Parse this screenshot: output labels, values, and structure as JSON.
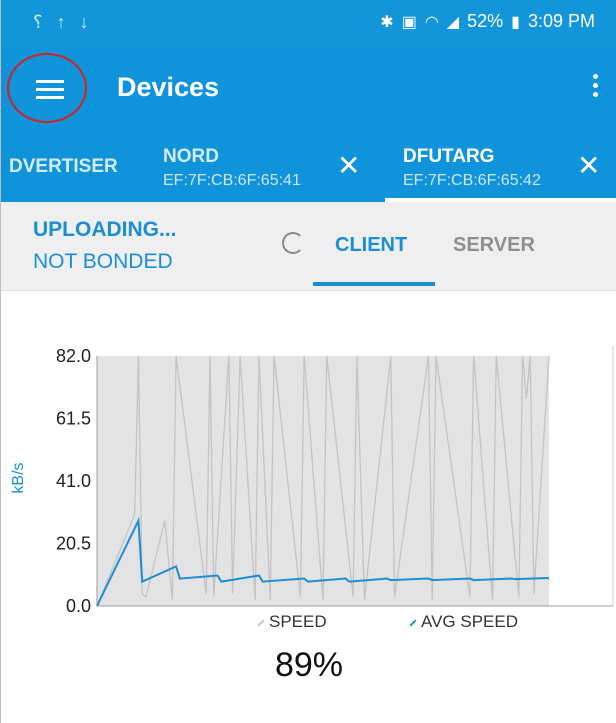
{
  "status_bar": {
    "left_icons": [
      "nfc-pay-icon",
      "upload-icon",
      "download-icon"
    ],
    "right_icons": [
      "bluetooth-icon",
      "nfc-icon",
      "wifi-icon",
      "signal-icon"
    ],
    "battery": "52%",
    "time": "3:09 PM"
  },
  "toolbar": {
    "title": "Devices",
    "menu_icon": "hamburger-menu-icon",
    "overflow_icon": "more-vert-icon"
  },
  "device_tabs": [
    {
      "name": "DVERTISER",
      "address": "",
      "selected": false
    },
    {
      "name": "NORD",
      "address": "EF:7F:CB:6F:65:41",
      "selected": false
    },
    {
      "name": "DFUTARG",
      "address": "EF:7F:CB:6F:65:42",
      "selected": true
    }
  ],
  "connection": {
    "state": "UPLOADING...",
    "bond": "NOT BONDED"
  },
  "role_tabs": [
    {
      "label": "CLIENT",
      "selected": true
    },
    {
      "label": "SERVER",
      "selected": false
    }
  ],
  "colors": {
    "primary": "#0f93db",
    "accent": "#1b8ed3",
    "speed_line": "#c4c4c4",
    "chart_fill": "#e3e3e3"
  },
  "chart_data": {
    "type": "line",
    "ylabel": "kB/s",
    "xlabel": "",
    "y_ticks": [
      "82.0",
      "61.5",
      "41.0",
      "20.5",
      "0.0"
    ],
    "ylim": [
      0,
      82
    ],
    "xlim": [
      0,
      120
    ],
    "grid": "vertical",
    "legend_position": "bottom",
    "series": [
      {
        "name": "SPEED",
        "x": [
          0,
          10,
          11,
          12,
          13,
          18,
          20,
          21,
          29,
          30,
          31,
          35,
          36,
          38,
          42,
          43,
          46,
          47,
          54,
          55,
          60,
          61,
          68,
          69,
          71,
          78,
          79,
          88,
          89,
          90,
          99,
          100,
          105,
          106,
          112,
          113,
          114,
          115,
          116,
          120
        ],
        "values": [
          0,
          30,
          82,
          4,
          3,
          28,
          2,
          82,
          4,
          82,
          3,
          82,
          4,
          82,
          2,
          82,
          2,
          82,
          3,
          82,
          2,
          82,
          3,
          82,
          2,
          82,
          3,
          82,
          2,
          82,
          3,
          82,
          2,
          82,
          3,
          82,
          68,
          82,
          4,
          82
        ]
      },
      {
        "name": "AVG SPEED",
        "x": [
          0,
          11,
          12,
          21,
          22,
          32,
          33,
          43,
          44,
          55,
          56,
          66,
          67,
          77,
          78,
          88,
          89,
          99,
          100,
          110,
          111,
          120
        ],
        "values": [
          0,
          28,
          8,
          13,
          9,
          10,
          8,
          10,
          8,
          9,
          8,
          9,
          8,
          9,
          8.5,
          9,
          8.5,
          9,
          8.5,
          9,
          8.8,
          9.2
        ]
      }
    ]
  },
  "legend": {
    "speed": "SPEED",
    "avg": "AVG SPEED"
  },
  "progress": {
    "percent_text": "89%",
    "value": 89
  }
}
